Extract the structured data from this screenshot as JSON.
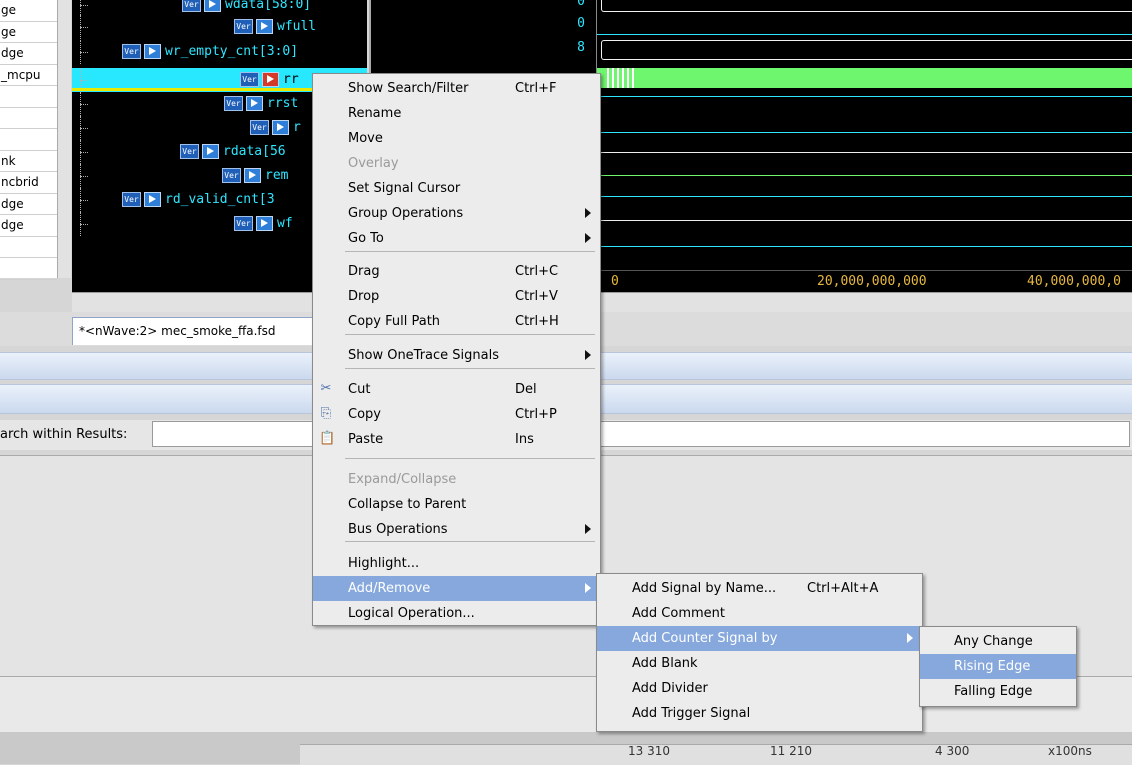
{
  "left_list": {
    "items": [
      "ge",
      "ge",
      "dge",
      "_mcpu",
      "",
      "",
      "",
      "nk",
      "ncbrid",
      "dge",
      "dge",
      "",
      ""
    ]
  },
  "signals": [
    {
      "label": "wdata[58:0]",
      "icons": true
    },
    {
      "label": "wfull",
      "icons": true
    },
    {
      "label": "wr_empty_cnt[3:0]",
      "icons": true
    },
    {
      "label": "rr",
      "icons": true
    },
    {
      "label": "rrst",
      "icons": true
    },
    {
      "label": "r",
      "icons": true
    },
    {
      "label": "rdata[56",
      "icons": true
    },
    {
      "label": "rem",
      "icons": true
    },
    {
      "label": "rd_valid_cnt[3",
      "icons": true
    },
    {
      "label": "wf",
      "icons": true
    }
  ],
  "badge_text": "Ver",
  "values": [
    "0",
    "0",
    "8"
  ],
  "ruler": {
    "t0": "0",
    "t1": "20,000,000,000",
    "t2": "40,000,000,0"
  },
  "tab": {
    "label": "*<nWave:2> mec_smoke_ffa.fsd"
  },
  "search": {
    "label": "arch within Results:",
    "value": ""
  },
  "status": {
    "s1": "13 310",
    "s2": "11 210",
    "s3": "4 300",
    "s4": "x100ns"
  },
  "colors": {
    "signal_text": "#2ee6ff",
    "selection": "#27e8ff",
    "bus_green": "#6ef76e",
    "menu_highlight": "#86a8dd",
    "ruler_text": "#e8b840"
  },
  "context_menu": {
    "items": [
      {
        "label": "Show Search/Filter",
        "shortcut": "Ctrl+F"
      },
      {
        "label": "Rename",
        "shortcut": ""
      },
      {
        "label": "Move",
        "shortcut": ""
      },
      {
        "label": "Overlay",
        "shortcut": "",
        "disabled": true
      },
      {
        "label": "Set Signal Cursor",
        "shortcut": ""
      },
      {
        "label": "Group Operations",
        "shortcut": "",
        "submenu": true
      },
      {
        "label": "Go To",
        "shortcut": "",
        "submenu": true
      },
      {
        "label": "Drag",
        "shortcut": "Ctrl+C"
      },
      {
        "label": "Drop",
        "shortcut": "Ctrl+V"
      },
      {
        "label": "Copy Full Path",
        "shortcut": "Ctrl+H"
      },
      {
        "label": "Show OneTrace Signals",
        "shortcut": "",
        "submenu": true
      },
      {
        "label": "Cut",
        "shortcut": "Del",
        "icon": "scissors-icon"
      },
      {
        "label": "Copy",
        "shortcut": "Ctrl+P",
        "icon": "copy-icon"
      },
      {
        "label": "Paste",
        "shortcut": "Ins",
        "icon": "paste-icon"
      },
      {
        "label": "Expand/Collapse",
        "shortcut": "",
        "disabled": true
      },
      {
        "label": "Collapse to Parent",
        "shortcut": ""
      },
      {
        "label": "Bus Operations",
        "shortcut": "",
        "submenu": true
      },
      {
        "label": "Highlight...",
        "shortcut": ""
      },
      {
        "label": "Add/Remove",
        "shortcut": "",
        "submenu": true,
        "highlighted": true
      },
      {
        "label": "Logical Operation...",
        "shortcut": ""
      }
    ]
  },
  "add_remove_menu": {
    "items": [
      {
        "label": "Add Signal by Name...",
        "shortcut": "Ctrl+Alt+A"
      },
      {
        "label": "Add Comment",
        "shortcut": ""
      },
      {
        "label": "Add Counter Signal by",
        "shortcut": "",
        "submenu": true,
        "highlighted": true
      },
      {
        "label": "Add Blank",
        "shortcut": ""
      },
      {
        "label": "Add Divider",
        "shortcut": ""
      },
      {
        "label": "Add Trigger Signal",
        "shortcut": ""
      }
    ]
  },
  "counter_menu": {
    "items": [
      {
        "label": "Any Change"
      },
      {
        "label": "Rising Edge",
        "highlighted": true
      },
      {
        "label": "Falling Edge"
      }
    ]
  }
}
